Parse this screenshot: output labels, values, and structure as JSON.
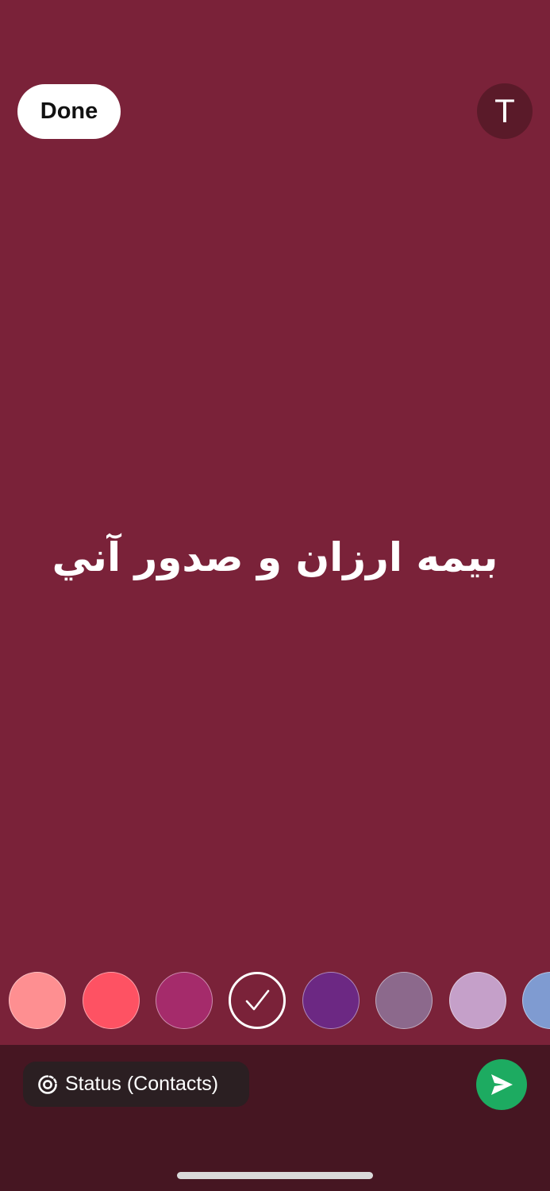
{
  "header": {
    "done_label": "Done",
    "font_button_label": "T"
  },
  "status": {
    "text": "بيمه ارزان و صدور آني",
    "background_color": "#7a2239"
  },
  "color_swatches": [
    {
      "color": "#fe8f91",
      "selected": false
    },
    {
      "color": "#fe5263",
      "selected": false
    },
    {
      "color": "#a52b6b",
      "selected": false
    },
    {
      "color": "#7a2239",
      "selected": true
    },
    {
      "color": "#6c2883",
      "selected": false
    },
    {
      "color": "#8c698c",
      "selected": false
    },
    {
      "color": "#c5a0c9",
      "selected": false
    },
    {
      "color": "#7f9bd1",
      "selected": false
    }
  ],
  "footer": {
    "audience_label": "Status (Contacts)",
    "audience_icon": "status-ring-icon",
    "send_icon": "send-arrow-icon",
    "send_color": "#1dab61"
  }
}
